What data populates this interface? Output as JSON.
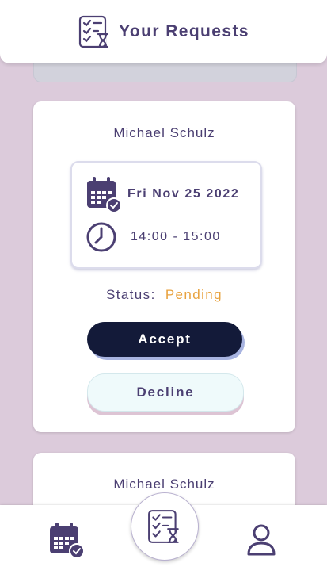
{
  "header": {
    "title": "Your Requests",
    "icon": "request-list-icon"
  },
  "requests": [
    {
      "name": "Michael Schulz",
      "date": "Fri Nov 25 2022",
      "time": "14:00 - 15:00",
      "status_label": "Status:",
      "status_value": "Pending",
      "accept_label": "Accept",
      "decline_label": "Decline"
    },
    {
      "name": "Michael Schulz"
    }
  ],
  "nav": {
    "items": [
      {
        "icon": "calendar-check-icon"
      },
      {
        "icon": "request-list-icon"
      },
      {
        "icon": "user-icon"
      }
    ]
  },
  "colors": {
    "background": "#dccbdb",
    "primary_text": "#4b3f72",
    "pending": "#e8a23e",
    "accept_bg": "#131a39",
    "decline_bg": "#effafb"
  }
}
